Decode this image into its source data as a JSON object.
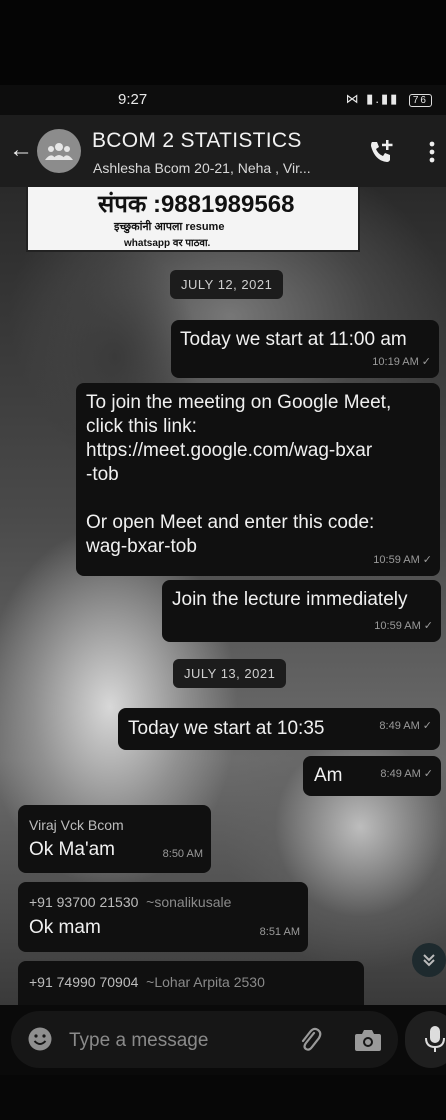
{
  "status_bar": {
    "time": "9:27",
    "signal_text": "·’‧ │ .││",
    "battery": "76"
  },
  "header": {
    "title": "BCOM 2 STATISTICS",
    "members": "Ashlesha Bcom 20-21, Neha , Vir..."
  },
  "prev_image": {
    "phone": "संपक :9881989568",
    "line2": "इच्छुकांनी आपला resume",
    "line3": "whatsapp वर पाठवा."
  },
  "dates": [
    "JULY 12, 2021",
    "JULY 13, 2021"
  ],
  "messages": [
    {
      "text": "Today we start at 11:00 am",
      "time": "10:19 AM",
      "tick": "✓"
    },
    {
      "text": "To join the meeting on Google Meet,\nclick this link:\nhttps://meet.google.com/wag-bxar\n-tob\n\nOr open Meet and enter this code:\nwag-bxar-tob",
      "time": "10:59 AM",
      "tick": "✓"
    },
    {
      "text": "Join the lecture immediately",
      "time": "10:59 AM",
      "tick": "✓"
    },
    {
      "text": "Today we start at 10:35",
      "time": "8:49 AM",
      "tick": "✓"
    },
    {
      "text": "Am",
      "time": "8:49 AM",
      "tick": "✓"
    },
    {
      "sender": "Viraj Vck Bcom",
      "text": "Ok Ma'am",
      "time": "8:50 AM"
    },
    {
      "sender": "+91 93700 21530",
      "sender_name": "~sonalikusale",
      "text": "Ok mam",
      "time": "8:51 AM"
    },
    {
      "sender": "+91 74990 70904",
      "sender_name": "~Lohar Arpita 2530"
    }
  ],
  "input": {
    "placeholder": "Type a message"
  },
  "colors": {
    "bubble": "#101010",
    "header": "#1d1d1d",
    "date_pill": "#1c1c1c"
  }
}
